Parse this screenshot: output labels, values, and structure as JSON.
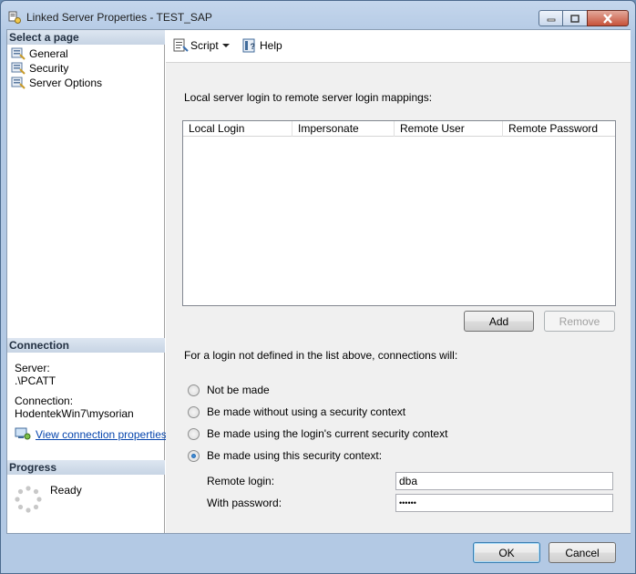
{
  "window": {
    "title": "Linked Server Properties - TEST_SAP"
  },
  "left": {
    "select_page_header": "Select a page",
    "pages": [
      {
        "label": "General"
      },
      {
        "label": "Security"
      },
      {
        "label": "Server Options"
      }
    ],
    "connection_header": "Connection",
    "server_label": "Server:",
    "server_value": ".\\PCATT",
    "connection_label": "Connection:",
    "connection_value": "HodentekWin7\\mysorian",
    "view_link": "View connection properties",
    "progress_header": "Progress",
    "progress_status": "Ready"
  },
  "toolbar": {
    "script_label": "Script",
    "help_label": "Help"
  },
  "main": {
    "mappings_label": "Local server login to remote server login mappings:",
    "columns": [
      "Local Login",
      "Impersonate",
      "Remote User",
      "Remote Password"
    ],
    "add_label": "Add",
    "remove_label": "Remove",
    "not_defined_label": "For a login not defined in the list above, connections will:",
    "options": [
      {
        "label": "Not be made",
        "checked": false
      },
      {
        "label": "Be made without using a security context",
        "checked": false
      },
      {
        "label": "Be made using the login's current security context",
        "checked": false
      },
      {
        "label": "Be made using this security context:",
        "checked": true
      }
    ],
    "remote_login_label": "Remote login:",
    "remote_login_value": "dba",
    "password_label": "With password:",
    "password_value": "••••••"
  },
  "footer": {
    "ok_label": "OK",
    "cancel_label": "Cancel"
  }
}
